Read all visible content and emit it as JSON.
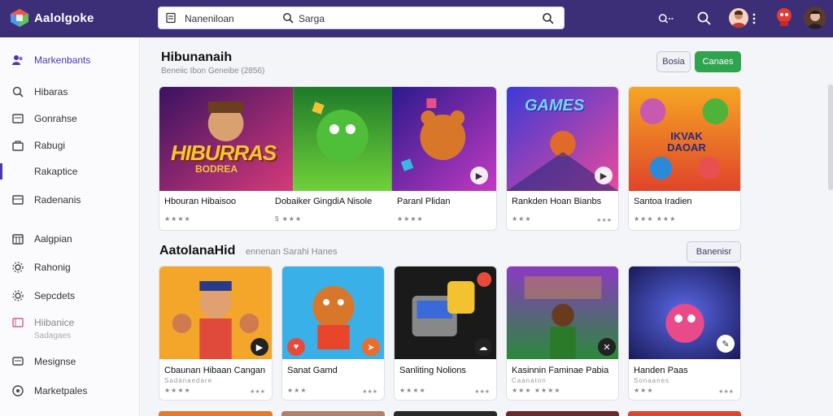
{
  "app": {
    "brand": "Aalolgoke",
    "search_left_text": "Naneniloan",
    "search_mid_text": "Sarga",
    "brand_color": "#3c2e77"
  },
  "sidebar": {
    "items": [
      {
        "label": "Markenbants",
        "icon": "people-icon"
      },
      {
        "label": "Hibaras",
        "icon": "search-icon"
      },
      {
        "label": "Gonrahse",
        "icon": "document-icon"
      },
      {
        "label": "Rabugi",
        "icon": "bag-icon"
      },
      {
        "label": "Rakaptice",
        "icon": "star-icon"
      },
      {
        "label": "Radenanis",
        "icon": "grid-icon"
      },
      {
        "label": "Aalgpian",
        "icon": "calendar-icon"
      },
      {
        "label": "Rahonig",
        "icon": "gear-icon"
      },
      {
        "label": "Sepcdets",
        "icon": "gear-icon"
      },
      {
        "label": "Hiibanice",
        "icon": "tag-icon",
        "sub": "Sadagaes"
      },
      {
        "label": "Mesignse",
        "icon": "message-icon"
      },
      {
        "label": "Marketpales",
        "icon": "globe-icon"
      }
    ]
  },
  "section1": {
    "title": "Hibunanaih",
    "subtitle": "Beneiic Ibon Geneibe (2856)",
    "btn_light": "Bosia",
    "btn_green": "Canaes",
    "cards": [
      {
        "title": "Hbouran Hibaisoo",
        "stars": "★★★★",
        "meta": "",
        "art_text": "HIBURRAS",
        "art_sub": "BODREA"
      },
      {
        "title": "Dobaiker GingdiA Nisole",
        "stars": "$ ★★★",
        "meta": "$ ★★",
        "art_text": "",
        "art_sub": ""
      },
      {
        "title": "Paranl Plidan",
        "stars": "★★★★",
        "meta": "★★★",
        "art_text": "",
        "art_sub": ""
      },
      {
        "title": "Rankden Hoan Bianbs",
        "stars": "★★★",
        "meta": "★★★",
        "art_text": "GAMES",
        "art_sub": ""
      },
      {
        "title": "Santoa Iradien",
        "stars": "★★★ ★★★",
        "meta": "",
        "art_text": "IKVAK DAOAR",
        "art_sub": ""
      }
    ]
  },
  "section2": {
    "title": "AatolanaHid",
    "subtitle": "ennenan Sarahi Hanes",
    "btn_light": "Banenisr",
    "cards": [
      {
        "title": "Cbaunan Hibaan Cangan",
        "stars": "★★★★",
        "meta": "★★★",
        "sub": "Sadanaedare"
      },
      {
        "title": "Sanat Gamd",
        "stars": "★★★",
        "meta": "★★★",
        "sub": ""
      },
      {
        "title": "Sanliting Nolions",
        "stars": "★★★★",
        "meta": "★★★",
        "sub": ""
      },
      {
        "title": "Kasinnin Faminae Pabia",
        "stars": "★★★ ★★★★",
        "meta": "",
        "sub": "Caanaton"
      },
      {
        "title": "Handen Paas",
        "stars": "★★★",
        "meta": "★★★",
        "sub": "Sonaanes"
      }
    ]
  }
}
